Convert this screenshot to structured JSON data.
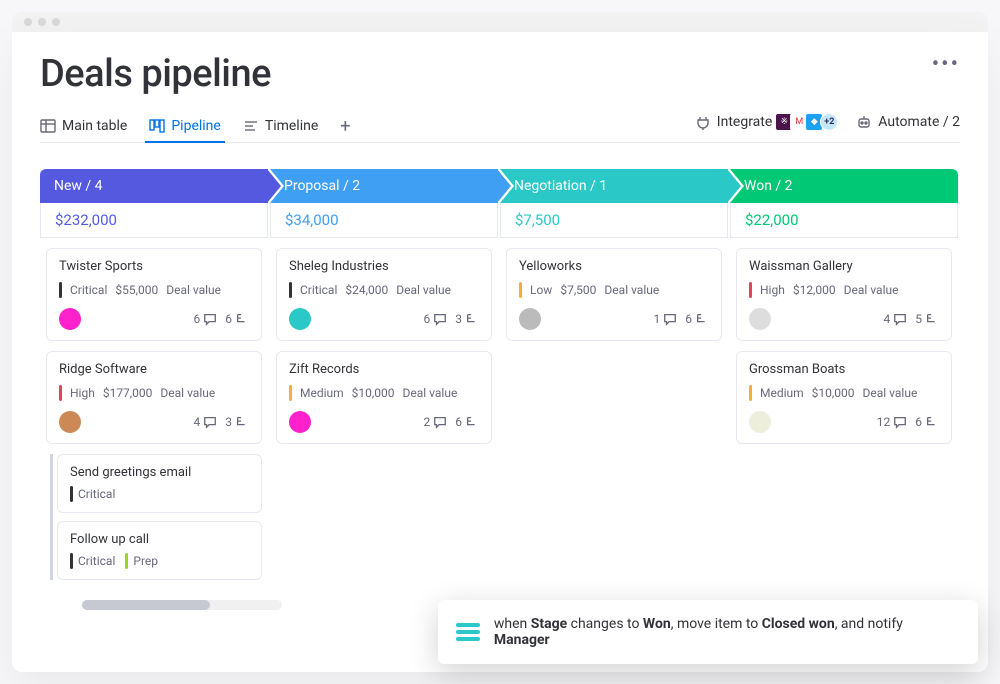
{
  "page": {
    "title": "Deals pipeline"
  },
  "tabs": {
    "main_table": "Main table",
    "pipeline": "Pipeline",
    "timeline": "Timeline"
  },
  "tools": {
    "integrate": "Integrate",
    "automate": "Automate / 2",
    "integrations_more": "+2"
  },
  "columns": [
    {
      "id": "new",
      "header": "New / 4",
      "total": "$232,000",
      "head_class": "c-new",
      "total_class": "c-new-total",
      "cards": [
        {
          "title": "Twister Sports",
          "priority": "Critical",
          "priority_class": "prio-critical",
          "value": "$55,000",
          "value_label": "Deal value",
          "comments": "6",
          "subitems": "6",
          "avatar": "#f2c"
        },
        {
          "title": "Ridge Software",
          "priority": "High",
          "priority_class": "prio-high",
          "value": "$177,000",
          "value_label": "Deal value",
          "comments": "4",
          "subitems": "3",
          "avatar": "#c85",
          "subcards": [
            {
              "title": "Send greetings email",
              "tags": [
                {
                  "label": "Critical",
                  "cls": "prio-critical"
                }
              ]
            },
            {
              "title": "Follow up call",
              "tags": [
                {
                  "label": "Critical",
                  "cls": "prio-critical"
                },
                {
                  "label": "Prep",
                  "cls": "prio-prep"
                }
              ]
            }
          ]
        }
      ]
    },
    {
      "id": "proposal",
      "header": "Proposal / 2",
      "total": "$34,000",
      "head_class": "c-prop",
      "total_class": "c-prop-total",
      "cards": [
        {
          "title": "Sheleg Industries",
          "priority": "Critical",
          "priority_class": "prio-critical",
          "value": "$24,000",
          "value_label": "Deal value",
          "comments": "6",
          "subitems": "3",
          "avatar": "#2bc8c8"
        },
        {
          "title": "Zift Records",
          "priority": "Medium",
          "priority_class": "prio-medium",
          "value": "$10,000",
          "value_label": "Deal value",
          "comments": "2",
          "subitems": "6",
          "avatar": "#f2c"
        }
      ]
    },
    {
      "id": "negotiation",
      "header": "Negotiation / 1",
      "total": "$7,500",
      "head_class": "c-neg",
      "total_class": "c-neg-total",
      "cards": [
        {
          "title": "Yelloworks",
          "priority": "Low",
          "priority_class": "prio-low",
          "value": "$7,500",
          "value_label": "Deal value",
          "comments": "1",
          "subitems": "6",
          "avatar": "#bbb"
        }
      ]
    },
    {
      "id": "won",
      "header": "Won / 2",
      "total": "$22,000",
      "head_class": "c-won",
      "total_class": "c-won-total",
      "cards": [
        {
          "title": "Waissman Gallery",
          "priority": "High",
          "priority_class": "prio-high",
          "value": "$12,000",
          "value_label": "Deal value",
          "comments": "4",
          "subitems": "5",
          "avatar": "#ddd"
        },
        {
          "title": "Grossman Boats",
          "priority": "Medium",
          "priority_class": "prio-medium",
          "value": "$10,000",
          "value_label": "Deal value",
          "comments": "12",
          "subitems": "6",
          "avatar": "#eed"
        }
      ]
    }
  ],
  "automation": {
    "text_prefix": "when ",
    "b1": "Stage",
    "mid1": " changes to ",
    "b2": "Won",
    "mid2": ", move item to ",
    "b3": "Closed won",
    "mid3": ", and notify ",
    "b4": "Manager"
  }
}
